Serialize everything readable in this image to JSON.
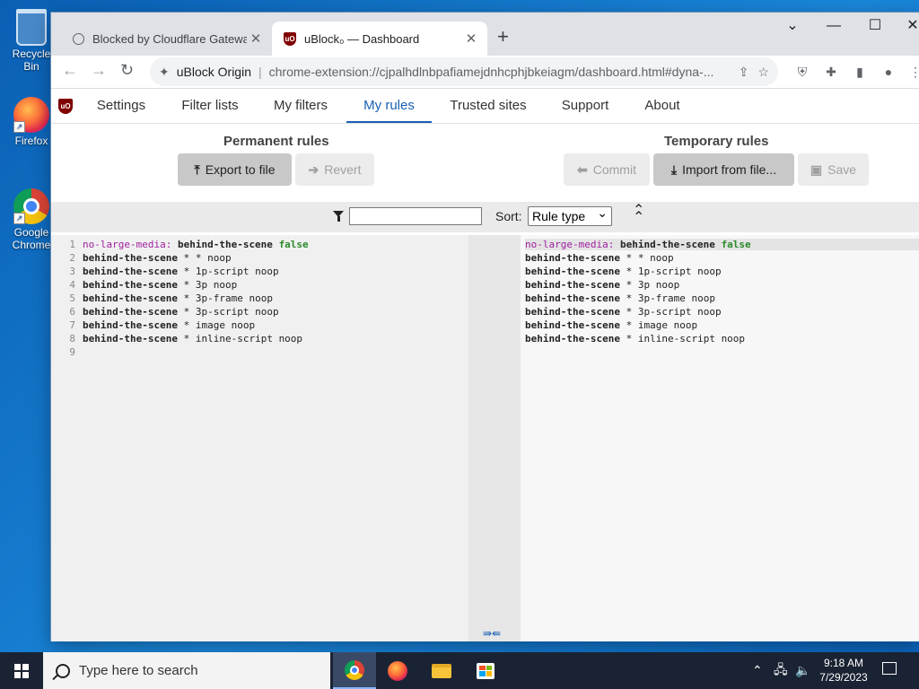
{
  "desktop": {
    "icons": [
      {
        "label": "Recycle Bin",
        "icon": "recycle-bin-icon"
      },
      {
        "label": "Firefox",
        "icon": "firefox-icon"
      },
      {
        "label": "Google Chrome",
        "icon": "chrome-icon"
      }
    ]
  },
  "browser": {
    "tabs": [
      {
        "title": "Blocked by Cloudflare Gateway",
        "icon": "globe-icon",
        "active": false
      },
      {
        "title": "uBlock₀ — Dashboard",
        "icon": "ublock-icon",
        "active": true
      }
    ],
    "new_tab": "+",
    "window_controls": {
      "tab_search": "⌄",
      "minimize": "—",
      "maximize": "☐",
      "close": "✕"
    },
    "address": {
      "origin": "uBlock Origin",
      "separator": "|",
      "url": "chrome-extension://cjpalhdlnbpafiamejdnhcphjbkeiagm/dashboard.html#dyna-..."
    }
  },
  "dashboard": {
    "nav": [
      "Settings",
      "Filter lists",
      "My filters",
      "My rules",
      "Trusted sites",
      "Support",
      "About"
    ],
    "nav_selected": "My rules",
    "permanent": {
      "title": "Permanent rules",
      "buttons": [
        {
          "label": "Export to file",
          "icon": "upload-icon",
          "enabled": true
        },
        {
          "label": "Revert",
          "icon": "arrow-right-icon",
          "enabled": false
        }
      ]
    },
    "temporary": {
      "title": "Temporary rules",
      "buttons": [
        {
          "label": "Commit",
          "icon": "arrow-left-icon",
          "enabled": false
        },
        {
          "label": "Import from file...",
          "icon": "download-icon",
          "enabled": true
        },
        {
          "label": "Save",
          "icon": "save-icon",
          "enabled": false
        }
      ]
    },
    "filter": {
      "value": "",
      "sort_label": "Sort:",
      "sort_value": "Rule type"
    },
    "permanent_rules": [
      "no-large-media: behind-the-scene false",
      "behind-the-scene * * noop",
      "behind-the-scene * 1p-script noop",
      "behind-the-scene * 3p noop",
      "behind-the-scene * 3p-frame noop",
      "behind-the-scene * 3p-script noop",
      "behind-the-scene * image noop",
      "behind-the-scene * inline-script noop",
      ""
    ],
    "line_numbers": [
      "1",
      "2",
      "3",
      "4",
      "5",
      "6",
      "7",
      "8",
      "9"
    ],
    "temporary_rules": [
      "no-large-media: behind-the-scene false",
      "behind-the-scene * * noop",
      "behind-the-scene * 1p-script noop",
      "behind-the-scene * 3p noop",
      "behind-the-scene * 3p-frame noop",
      "behind-the-scene * 3p-script noop",
      "behind-the-scene * image noop",
      "behind-the-scene * inline-script noop"
    ],
    "merge_arrows": "⇛⇚"
  },
  "taskbar": {
    "search_placeholder": "Type here to search",
    "apps": [
      "chrome-icon",
      "firefox-icon",
      "file-explorer-icon",
      "store-icon"
    ],
    "time": "9:18 AM",
    "date": "7/29/2023"
  },
  "colors": {
    "accent": "#1a5fb4",
    "ublock_red": "#800000",
    "keyword": "#a020a0",
    "value_green": "#2a8a2a"
  }
}
